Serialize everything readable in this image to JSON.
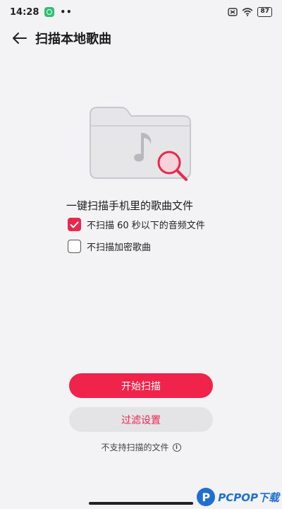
{
  "status_bar": {
    "time": "14:28",
    "dots": "••",
    "battery": "87"
  },
  "header": {
    "title": "扫描本地歌曲"
  },
  "main": {
    "heading": "一键扫描手机里的歌曲文件",
    "options": [
      {
        "label": "不扫描 60 秒以下的音频文件",
        "checked": true
      },
      {
        "label": "不扫描加密歌曲",
        "checked": false
      }
    ],
    "start_button": "开始扫描",
    "filter_button": "过滤设置",
    "unsupported_link": "不支持扫描的文件"
  },
  "watermark": {
    "logo": "P",
    "text": "PCPOP下载"
  },
  "colors": {
    "accent": "#f0234a",
    "background": "#f3f3f5"
  }
}
